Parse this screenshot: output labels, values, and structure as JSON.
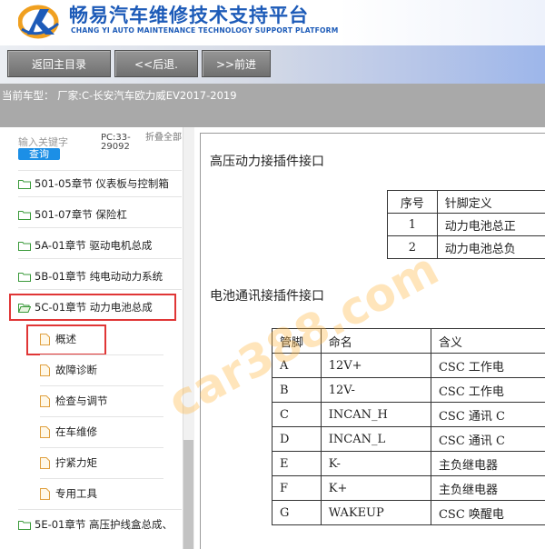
{
  "header": {
    "title": "畅易汽车维修技术支持平台",
    "subtitle": "CHANG YI AUTO MAINTENANCE TECHNOLOGY SUPPORT PLATFORM"
  },
  "toolbar": {
    "home_label": "返回主目录",
    "back_label": "<<后退.",
    "forward_label": ">>前进"
  },
  "vehicle": {
    "text": "当前车型： 厂家:C-长安汽车欧力威EV2017-2019"
  },
  "left": {
    "search_placeholder": "输入关键字",
    "search_button": "查询",
    "pc_code": "PC:33-29092",
    "fold_all": "折叠全部",
    "tree": [
      {
        "label": "501-05章节 仪表板与控制箱",
        "level": 1
      },
      {
        "label": "501-07章节 保险杠",
        "level": 1
      },
      {
        "label": "5A-01章节 驱动电机总成",
        "level": 1
      },
      {
        "label": "5B-01章节 纯电动动力系统",
        "level": 1
      },
      {
        "label": "5C-01章节 动力电池总成",
        "level": 1,
        "open": true
      },
      {
        "label": "概述",
        "level": 2,
        "selected": true
      },
      {
        "label": "故障诊断",
        "level": 2
      },
      {
        "label": "检查与调节",
        "level": 2
      },
      {
        "label": "在车维修",
        "level": 2
      },
      {
        "label": "拧紧力矩",
        "level": 2
      },
      {
        "label": "专用工具",
        "level": 2
      },
      {
        "label": "5E-01章节 高压护线盒总成、",
        "level": 1
      }
    ]
  },
  "content": {
    "section1_title": "高压动力接插件接口",
    "table1": {
      "headers": [
        "序号",
        "针脚定义"
      ],
      "rows": [
        [
          "1",
          "动力电池总正"
        ],
        [
          "2",
          "动力电池总负"
        ]
      ]
    },
    "section2_title": "电池通讯接插件接口",
    "table2": {
      "headers": [
        "管脚",
        "命名",
        "含义"
      ],
      "rows": [
        [
          "A",
          "12V+",
          "CSC 工作电"
        ],
        [
          "B",
          "12V-",
          "CSC 工作电"
        ],
        [
          "C",
          "INCAN_H",
          "CSC 通讯 C"
        ],
        [
          "D",
          "INCAN_L",
          "CSC 通讯 C"
        ],
        [
          "E",
          "K-",
          "主负继电器"
        ],
        [
          "F",
          "K+",
          "主负继电器"
        ],
        [
          "G",
          "WAKEUP",
          "CSC 唤醒电"
        ]
      ]
    },
    "watermark": "car388.com"
  },
  "colors": {
    "brand_blue": "#1d5bb8",
    "selection_red": "#e03636",
    "search_blue": "#1c8fe6"
  }
}
